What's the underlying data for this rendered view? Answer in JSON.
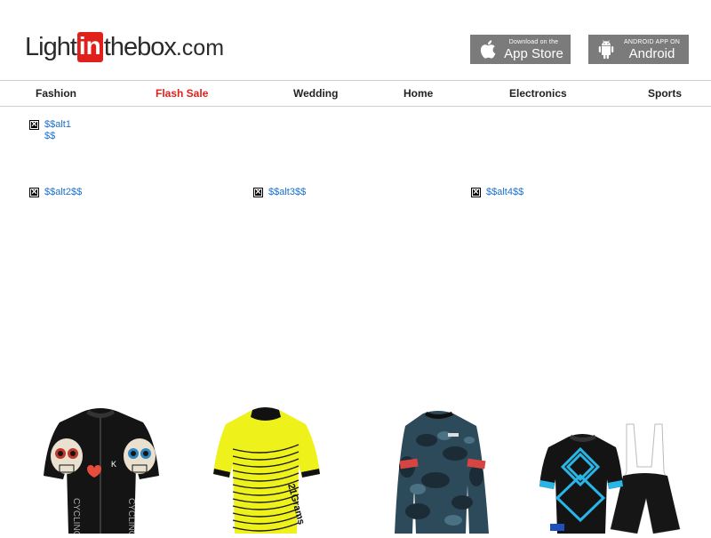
{
  "header": {
    "logo": {
      "part1": "Light",
      "part2": "in",
      "part3": "thebox",
      "part4": ".com"
    },
    "app_store": {
      "small": "Download on the",
      "big": "App Store",
      "icon": "apple-icon"
    },
    "android": {
      "small": "ANDROID APP ON",
      "big": "Android",
      "icon": "android-icon"
    }
  },
  "nav": {
    "items": [
      "Fashion",
      "Flash Sale",
      "Wedding",
      "Home",
      "Electronics",
      "Sports"
    ],
    "accent_color": "#e0201b"
  },
  "banners": [
    {
      "alt": "$$alt1$$"
    },
    {
      "alt": "$$alt2$$"
    },
    {
      "alt": "$$alt3$$"
    },
    {
      "alt": "$$alt4$$"
    }
  ],
  "products": [
    {
      "icon": "black-skull-cycling-jersey"
    },
    {
      "icon": "yellow-cycling-jersey"
    },
    {
      "icon": "camo-cycling-jersey"
    },
    {
      "icon": "blue-black-cycling-kit"
    }
  ]
}
